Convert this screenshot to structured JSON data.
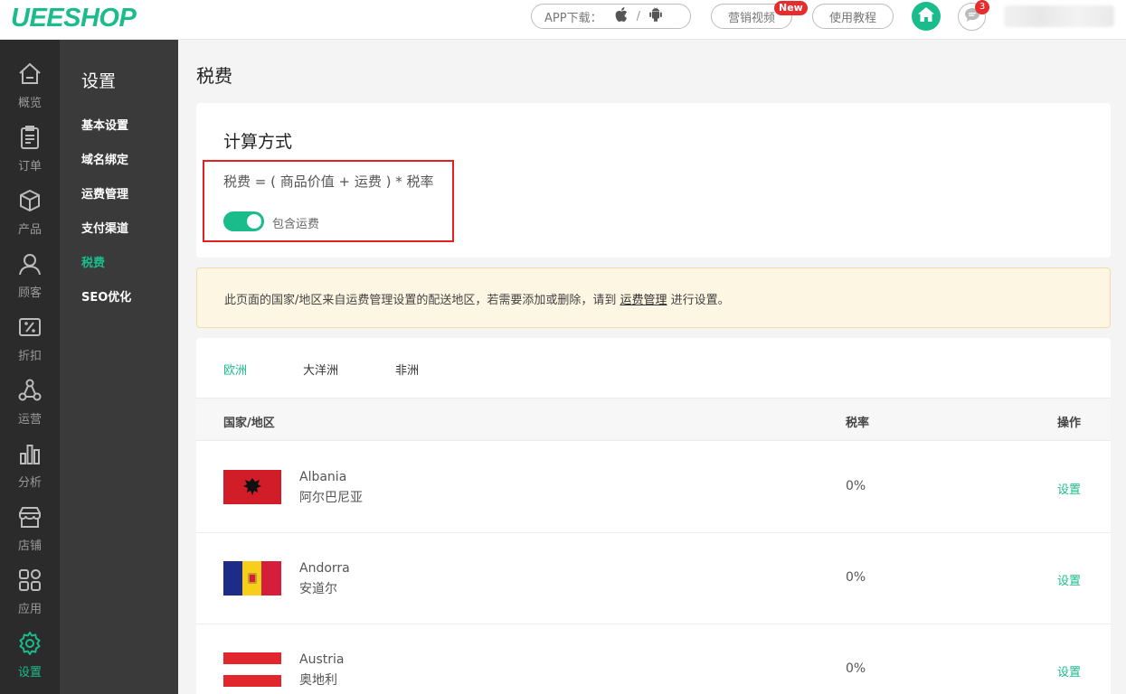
{
  "header": {
    "logo": "UEESHOP",
    "app_download_label": "APP下载：",
    "app_separator": "/",
    "marketing_video_label": "营销视频",
    "new_badge": "New",
    "tutorial_label": "使用教程",
    "message_count": "3",
    "brand_color": "#1abc8c"
  },
  "rail": {
    "items": [
      {
        "label": "概览",
        "icon": "home-outline-icon"
      },
      {
        "label": "订单",
        "icon": "clipboard-icon"
      },
      {
        "label": "产品",
        "icon": "box-icon"
      },
      {
        "label": "顾客",
        "icon": "user-icon"
      },
      {
        "label": "折扣",
        "icon": "discount-icon"
      },
      {
        "label": "运营",
        "icon": "network-icon"
      },
      {
        "label": "分析",
        "icon": "bar-chart-icon"
      },
      {
        "label": "店铺",
        "icon": "store-icon"
      },
      {
        "label": "应用",
        "icon": "apps-icon"
      },
      {
        "label": "设置",
        "icon": "gear-icon"
      }
    ]
  },
  "submenu": {
    "title": "设置",
    "items": [
      {
        "label": "基本设置"
      },
      {
        "label": "域名绑定"
      },
      {
        "label": "运费管理"
      },
      {
        "label": "支付渠道"
      },
      {
        "label": "税费"
      },
      {
        "label": "SEO优化"
      }
    ]
  },
  "main": {
    "page_title": "税费",
    "calc": {
      "title": "计算方式",
      "formula": "税费 = ( 商品价值 + 运费 ) * 税率",
      "toggle_label": "包含运费",
      "toggle_on": true
    },
    "notice": {
      "text_before": "此页面的国家/地区来自运费管理设置的配送地区，若需要添加或删除，请到 ",
      "link": "运费管理",
      "text_after": " 进行设置。"
    },
    "tabs": [
      {
        "label": "欧洲"
      },
      {
        "label": "大洋洲"
      },
      {
        "label": "非洲"
      }
    ],
    "table": {
      "headers": {
        "country": "国家/地区",
        "rate": "税率",
        "action": "操作"
      },
      "rows": [
        {
          "name_en": "Albania",
          "name_zh": "阿尔巴尼亚",
          "rate": "0%",
          "action": "设置"
        },
        {
          "name_en": "Andorra",
          "name_zh": "安道尔",
          "rate": "0%",
          "action": "设置"
        },
        {
          "name_en": "Austria",
          "name_zh": "奥地利",
          "rate": "0%",
          "action": "设置"
        }
      ]
    }
  }
}
